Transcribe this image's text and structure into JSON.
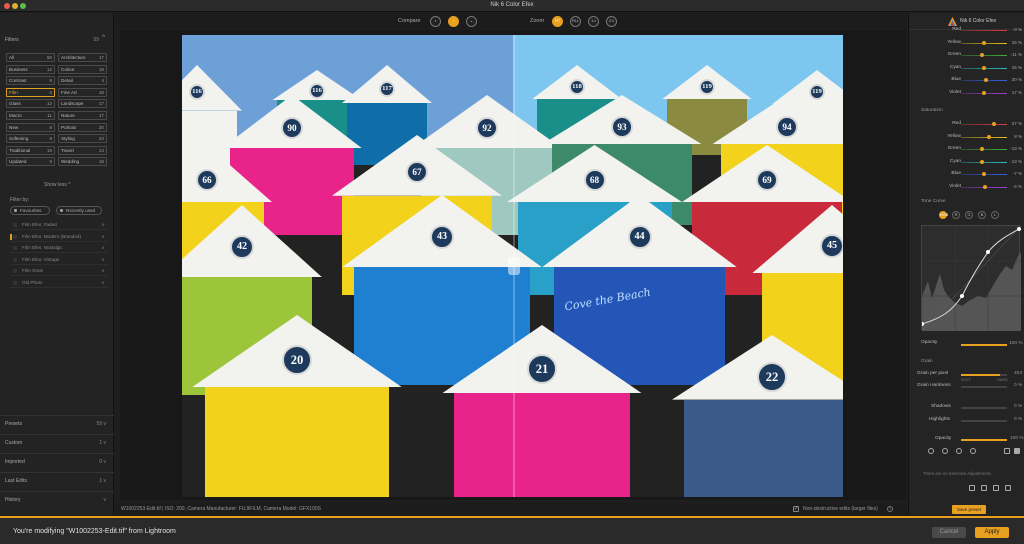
{
  "window": {
    "title": "Nik 6 Color Efex"
  },
  "left": {
    "filters_label": "Filters",
    "filters_count": "59",
    "categories": [
      {
        "label": "All",
        "count": "55"
      },
      {
        "label": "Architecture",
        "count": "17"
      },
      {
        "label": "Business",
        "count": "12"
      },
      {
        "label": "Colour",
        "count": "19"
      },
      {
        "label": "Contrast",
        "count": "8"
      },
      {
        "label": "Detail",
        "count": "4"
      },
      {
        "label": "Film",
        "count": "6"
      },
      {
        "label": "Fine Art",
        "count": "18"
      },
      {
        "label": "Glass",
        "count": "12"
      },
      {
        "label": "Landscape",
        "count": "17"
      },
      {
        "label": "Macro",
        "count": "11"
      },
      {
        "label": "Nature",
        "count": "17"
      },
      {
        "label": "New",
        "count": "8"
      },
      {
        "label": "Portrait",
        "count": "20"
      },
      {
        "label": "Softening",
        "count": "8"
      },
      {
        "label": "Styling",
        "count": "23"
      },
      {
        "label": "Traditional",
        "count": "19"
      },
      {
        "label": "Travel",
        "count": "14"
      },
      {
        "label": "Updated",
        "count": "9"
      },
      {
        "label": "Wedding",
        "count": "18"
      }
    ],
    "show_less": "Show less",
    "filter_by": "Filter by:",
    "favourites": "Favourites",
    "recently_used": "Recently used",
    "filter_list": [
      "Film Efex: Faded",
      "Film Efex: Modern (Branded)",
      "Film Efex: Nostalgic",
      "Film Efex: Vintage",
      "Film Grain",
      "Old Photo"
    ],
    "presets": {
      "label": "Presets",
      "count": "59"
    },
    "custom": {
      "label": "Custom",
      "count": "1"
    },
    "imported": {
      "label": "Imported",
      "count": "0"
    },
    "last_edits": {
      "label": "Last Edits",
      "count": "1"
    },
    "history": {
      "label": "History"
    }
  },
  "toolbar": {
    "compare": "Compare",
    "zoom": "Zoom",
    "zoom_fit": "FIT",
    "zoom_fill": "FILL",
    "zoom_1": "1:1",
    "zoom_2": "2:1"
  },
  "photo": {
    "hut_numbers": [
      "116",
      "117",
      "118",
      "119",
      "90",
      "91",
      "92",
      "93",
      "94",
      "66",
      "67",
      "68",
      "69",
      "42",
      "43",
      "44",
      "45",
      "20",
      "21",
      "22"
    ],
    "sign": "Cove the Beach",
    "colors": {
      "pink": "#e8248a",
      "yellow": "#f2d21a",
      "blue": "#1f7fd0",
      "green": "#9cc53a",
      "navy": "#2456b8",
      "red": "#c82a3c"
    }
  },
  "status": {
    "meta": "W1002253-Edit.tif  |  ISO: 200, Camera Manufacturer: FUJIFILM, Camera Model: GFX100S",
    "nondestructive": "Non-destructive edits (larger files)"
  },
  "right": {
    "title": "Nik 6 Color Efex",
    "hue_rows": [
      {
        "label": "Red",
        "value": "-0 %"
      },
      {
        "label": "Yellow",
        "value": "15 %",
        "pos": 0.5
      },
      {
        "label": "Green",
        "value": "-11 %",
        "pos": 0.45
      },
      {
        "label": "Cyan",
        "value": "16 %",
        "pos": 0.5
      },
      {
        "label": "Blue",
        "value": "20 %",
        "pos": 0.55
      },
      {
        "label": "Violet",
        "value": "17 %",
        "pos": 0.5
      }
    ],
    "saturation_label": "Saturation",
    "sat_rows": [
      {
        "label": "Red",
        "value": "27 %",
        "pos": 0.72
      },
      {
        "label": "Yellow",
        "value": "8 %",
        "pos": 0.6
      },
      {
        "label": "Green",
        "value": "-13 %",
        "pos": 0.45
      },
      {
        "label": "Cyan",
        "value": "-13 %",
        "pos": 0.45
      },
      {
        "label": "Blue",
        "value": "-7 %",
        "pos": 0.5
      },
      {
        "label": "Violet",
        "value": "-4 %",
        "pos": 0.52
      }
    ],
    "tone_curve": "Tone Curve",
    "channels": [
      "RGB",
      "R",
      "G",
      "B",
      "L"
    ],
    "opacity": "Opacity",
    "opacity_value": "100 %",
    "grain": "Grain",
    "grain_per_pixel": "Grain per pixel",
    "grain_per_pixel_value": "404",
    "grain_hardness": "Grain Hardness",
    "grain_hardness_value": "0 %",
    "soft": "SOFT",
    "hard": "HARD",
    "shadows": "Shadows",
    "shadows_value": "0 %",
    "highlights": "Highlights",
    "highlights_value": "0 %",
    "opacity2": "Opacity",
    "opacity2_value": "100 %",
    "selective_note": "There are no Selective Adjustments",
    "save_preset": "Save preset"
  },
  "footer": {
    "message": "You're modifying \"W1002253-Edit.tif\" from Lightroom",
    "cancel": "Cancel",
    "apply": "Apply"
  }
}
